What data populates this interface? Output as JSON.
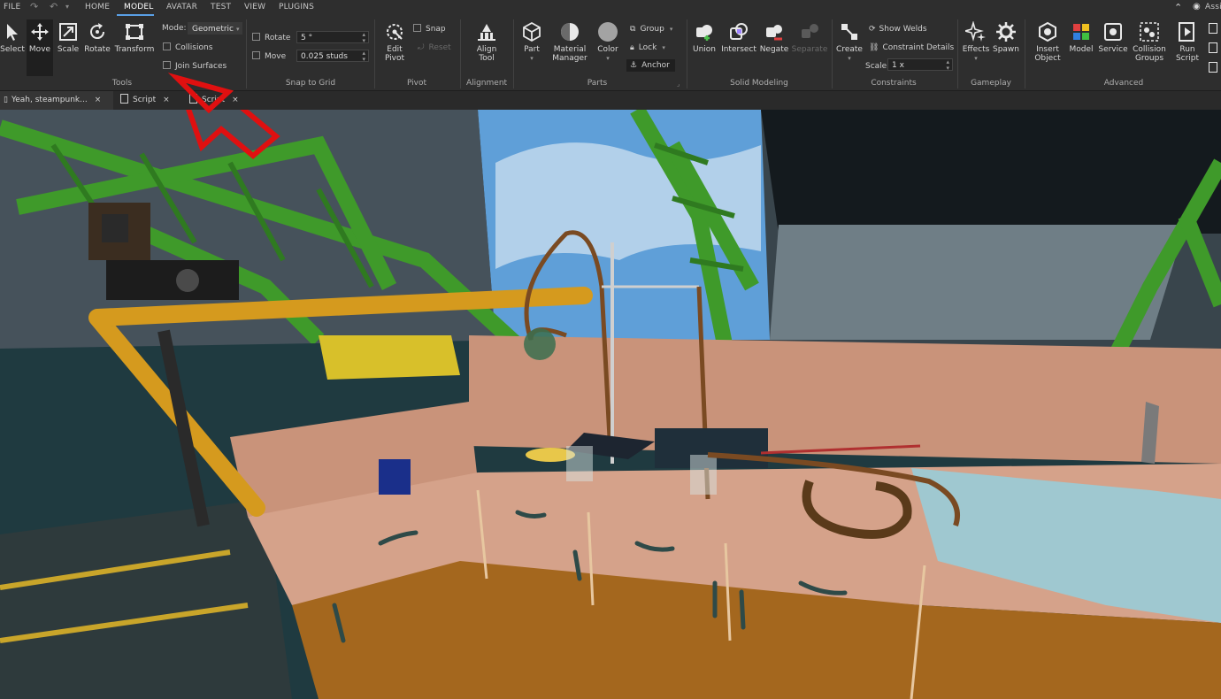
{
  "menu": {
    "items": [
      "FILE",
      "HOME",
      "MODEL",
      "AVATAR",
      "TEST",
      "VIEW",
      "PLUGINS"
    ],
    "active": "MODEL",
    "assistant": "Assis"
  },
  "ribbon": {
    "tools": {
      "select": "Select",
      "move": "Move",
      "scale": "Scale",
      "rotate": "Rotate",
      "transform": "Transform",
      "group_label": "Tools"
    },
    "mode": {
      "label": "Mode:",
      "value": "Geometric"
    },
    "collisions": "Collisions",
    "join_surfaces": "Join Surfaces",
    "snap": {
      "rotate_label": "Rotate",
      "rotate_value": "5 °",
      "move_label": "Move",
      "move_value": "0.025 studs",
      "group_label": "Snap to Grid"
    },
    "pivot": {
      "edit": "Edit",
      "pivot": "Pivot",
      "snap": "Snap",
      "reset": "Reset",
      "group_label": "Pivot"
    },
    "alignment": {
      "align": "Align",
      "tool": "Tool",
      "group_label": "Alignment"
    },
    "parts": {
      "part": "Part",
      "material": "Material",
      "manager": "Manager",
      "color": "Color",
      "group": "Group",
      "lock": "Lock",
      "anchor": "Anchor",
      "group_label": "Parts"
    },
    "solid": {
      "union": "Union",
      "intersect": "Intersect",
      "negate": "Negate",
      "separate": "Separate",
      "group_label": "Solid Modeling"
    },
    "constraints": {
      "create": "Create",
      "show_welds": "Show Welds",
      "constraint_details": "Constraint Details",
      "scale_label": "Scale",
      "scale_value": "1 x",
      "group_label": "Constraints"
    },
    "gameplay": {
      "effects": "Effects",
      "spawn": "Spawn",
      "group_label": "Gameplay"
    },
    "advanced": {
      "insert": "Insert",
      "object": "Object",
      "model": "Model",
      "service": "Service",
      "collision": "Collision",
      "groups": "Groups",
      "run": "Run",
      "script": "Script",
      "group_label": "Advanced"
    }
  },
  "tabs": [
    {
      "label": "Yeah, steampunk...",
      "close": "×"
    },
    {
      "label": "Script",
      "close": "×"
    },
    {
      "label": "Script",
      "close": "×"
    }
  ],
  "colors": {
    "arrow": "#e01010",
    "ribbon_bg": "#2e2e2e",
    "girder_green": "#3f9a2a"
  }
}
